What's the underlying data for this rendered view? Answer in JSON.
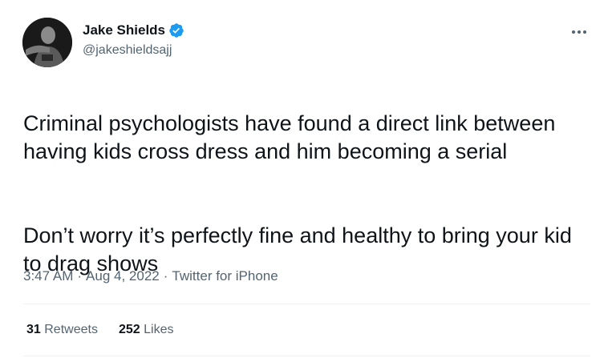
{
  "author": {
    "display_name": "Jake Shields",
    "handle": "@jakeshieldsajj",
    "verified": true
  },
  "tweet": {
    "paragraphs": [
      "Criminal psychologists have found a direct link between having kids cross dress and him becoming a serial",
      "Don’t worry it’s perfectly fine and healthy to bring your kid to drag shows"
    ],
    "time": "3:47 AM",
    "date": "Aug 4, 2022",
    "source": "Twitter for iPhone",
    "separator": "·"
  },
  "stats": {
    "retweets_count": "31",
    "retweets_label": "Retweets",
    "likes_count": "252",
    "likes_label": "Likes"
  },
  "colors": {
    "text_primary": "#0f1419",
    "text_secondary": "#536471",
    "verified_blue": "#1d9bf0",
    "divider": "#eff3f4"
  },
  "icons": {
    "verified": "verified-badge-icon",
    "more": "more-options-icon"
  }
}
